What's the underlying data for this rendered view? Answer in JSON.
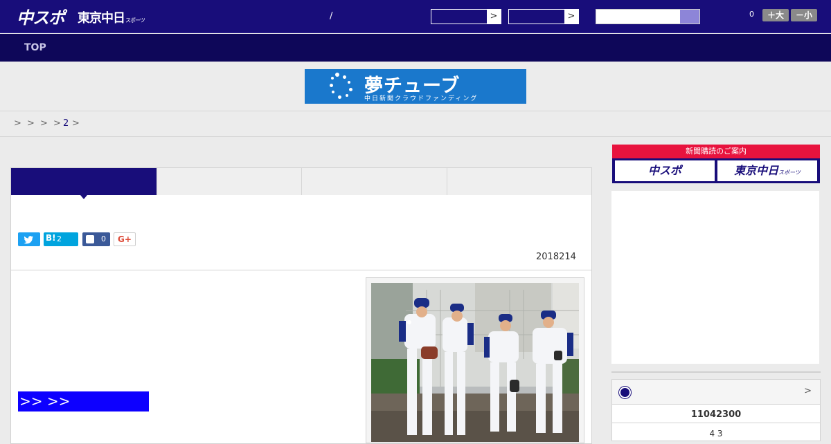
{
  "header": {
    "logo_main": "中スポ",
    "logo_sub": "東京中日",
    "logo_sub_small": "スポーツ",
    "slash": "/",
    "select1_arrow": ">",
    "select2_arrow": ">",
    "fontsize_count": "0",
    "font_larger": "＋大",
    "font_smaller": "－小"
  },
  "subnav": {
    "top": "TOP"
  },
  "banner": {
    "title": "夢チューブ",
    "subtitle": "中日新聞クラウドファンディング"
  },
  "breadcrumb": {
    "sep": ">",
    "page": "2"
  },
  "article": {
    "share": {
      "hatena_label": "B!",
      "hatena_count": "2",
      "facebook_count": "0",
      "gplus_label": "G+"
    },
    "date": "2018214",
    "link_text": ">> >>"
  },
  "sidebar": {
    "promo_top": "新聞購読のご案内",
    "promo_left": "中スポ",
    "promo_right": "東京中日",
    "promo_right_small": "スポーツ",
    "score_chevron": ">",
    "score_line1": "11042300",
    "score_line2": "4  3"
  },
  "colors": {
    "brand": "#180d7a",
    "brand_dark": "#0e0759",
    "accent_red": "#e8133e",
    "banner_blue": "#1a78cc",
    "link_blue": "#0d00ff"
  }
}
